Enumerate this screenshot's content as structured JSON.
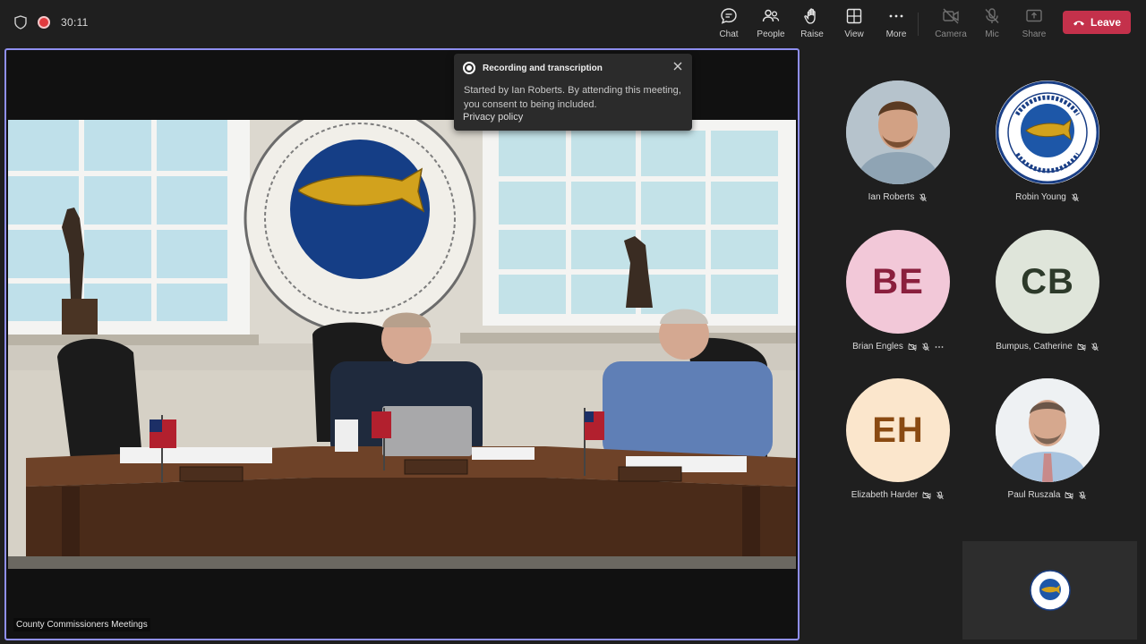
{
  "topbar": {
    "timer": "30:11",
    "buttons": [
      {
        "label": "Chat",
        "icon": "chat-icon"
      },
      {
        "label": "People",
        "icon": "people-icon"
      },
      {
        "label": "Raise",
        "icon": "raise-hand-icon"
      },
      {
        "label": "View",
        "icon": "view-icon"
      },
      {
        "label": "More",
        "icon": "more-icon"
      },
      {
        "label": "Camera",
        "icon": "camera-off-icon"
      },
      {
        "label": "Mic",
        "icon": "mic-off-icon"
      },
      {
        "label": "Share",
        "icon": "share-icon"
      }
    ],
    "leave_label": "Leave"
  },
  "toast": {
    "title": "Recording and transcription",
    "body": "Started by Ian Roberts. By attending this meeting, you consent to being included.",
    "link": "Privacy policy"
  },
  "stage": {
    "label": "County Commissioners Meetings"
  },
  "participants": [
    {
      "name": "Ian Roberts",
      "initials": "",
      "avatar": "photo"
    },
    {
      "name": "Robin Young",
      "initials": "",
      "avatar": "seal"
    },
    {
      "name": "Brian Engles",
      "initials": "BE",
      "avatar": "initials",
      "bg": "#f2c8d8",
      "fg": "#8a1f3d"
    },
    {
      "name": "Bumpus, Catherine",
      "initials": "CB",
      "avatar": "initials",
      "bg": "#dfe5da",
      "fg": "#2d3a2a"
    },
    {
      "name": "Elizabeth Harder",
      "initials": "EH",
      "avatar": "initials",
      "bg": "#fbe6cc",
      "fg": "#8a4a12"
    },
    {
      "name": "Paul Ruszala",
      "initials": "",
      "avatar": "photo"
    }
  ],
  "colors": {
    "accent": "#8f8ff0",
    "leave": "#c4314b",
    "background": "#1f1f1f"
  }
}
